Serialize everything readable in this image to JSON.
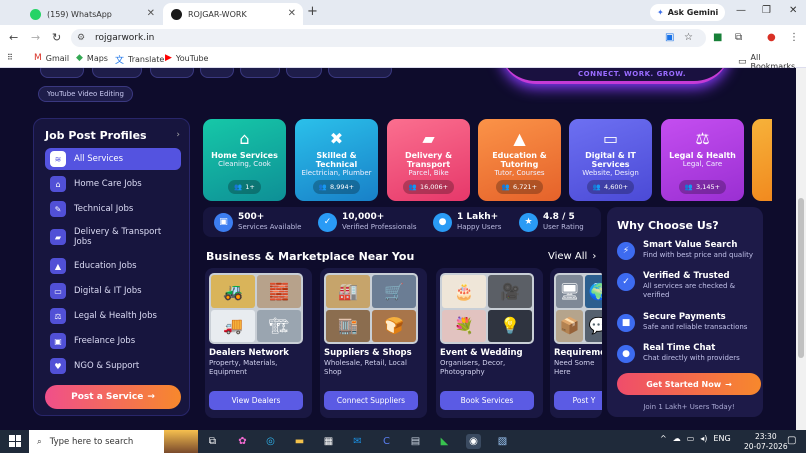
{
  "browser": {
    "tabs": [
      {
        "title": "(159) WhatsApp",
        "icon": "whatsapp-icon",
        "color": "#25d366"
      },
      {
        "title": "ROJGAR-WORK",
        "icon": "site-icon",
        "color": "#1a1a1a"
      }
    ],
    "new_tab": "+",
    "gemini": "Ask Gemini",
    "url": "rojgarwork.in",
    "bookmarks": [
      {
        "label": "Gmail",
        "icon": "gmail-icon"
      },
      {
        "label": "Maps",
        "icon": "maps-icon"
      },
      {
        "label": "Translate",
        "icon": "translate-icon"
      },
      {
        "label": "YouTube",
        "icon": "youtube-icon"
      }
    ],
    "all_bookmarks": "All Bookmarks"
  },
  "chips": [
    "YouTube Video Editing"
  ],
  "hero_text": "CONNECT. WORK. GROW.",
  "sidebar": {
    "title": "Job Post Profiles",
    "items": [
      {
        "label": "All Services",
        "icon": "layers-icon",
        "active": true
      },
      {
        "label": "Home Care Jobs",
        "icon": "home-icon"
      },
      {
        "label": "Technical Jobs",
        "icon": "wrench-icon"
      },
      {
        "label": "Delivery & Transport Jobs",
        "icon": "truck-icon"
      },
      {
        "label": "Education Jobs",
        "icon": "graduation-icon"
      },
      {
        "label": "Digital & IT Jobs",
        "icon": "laptop-icon"
      },
      {
        "label": "Legal & Health Jobs",
        "icon": "scale-icon"
      },
      {
        "label": "Freelance Jobs",
        "icon": "briefcase-icon"
      },
      {
        "label": "NGO & Support",
        "icon": "heart-hand-icon"
      }
    ],
    "post_button": "Post a Service"
  },
  "categories": [
    {
      "title": "Home Services",
      "sub": "Cleaning, Cook",
      "count": "1+",
      "icon": "home-icon",
      "color": "#12b4a0"
    },
    {
      "title": "Skilled & Technical",
      "sub": "Electrician, Plumber",
      "count": "8,994+",
      "icon": "tools-icon",
      "color": "#1aa6d8"
    },
    {
      "title": "Delivery & Transport",
      "sub": "Parcel, Bike",
      "count": "16,006+",
      "icon": "truck-icon",
      "color": "#f0567c"
    },
    {
      "title": "Education & Tutoring",
      "sub": "Tutor, Courses",
      "count": "6,721+",
      "icon": "graduation-icon",
      "color": "#f57d3a"
    },
    {
      "title": "Digital & IT Services",
      "sub": "Website, Design",
      "count": "4,600+",
      "icon": "laptop-icon",
      "color": "#5b5fe6"
    },
    {
      "title": "Legal & Health",
      "sub": "Legal, Care",
      "count": "3,145+",
      "icon": "scale-icon",
      "color": "#b43fe0"
    }
  ],
  "stats": [
    {
      "value": "500+",
      "label": "Services Available",
      "icon": "briefcase-icon",
      "color": "#3c7df0"
    },
    {
      "value": "10,000+",
      "label": "Verified Professionals",
      "icon": "check-icon",
      "color": "#2a9bf5"
    },
    {
      "value": "1 Lakh+",
      "label": "Happy Users",
      "icon": "user-icon",
      "color": "#2a9bf5"
    },
    {
      "value": "4.8 / 5",
      "label": "User Rating",
      "icon": "star-icon",
      "color": "#2a9bf5"
    }
  ],
  "business": {
    "title": "Business & Marketplace Near You",
    "view_all": "View All",
    "cards": [
      {
        "title": "Dealers Network",
        "desc": "Property, Materials, Equipment",
        "button": "View Dealers",
        "icons": [
          "🚜",
          "🧱",
          "🚚",
          "🏗"
        ]
      },
      {
        "title": "Suppliers & Shops",
        "desc": "Wholesale, Retail, Local Shop",
        "button": "Connect Suppliers",
        "icons": [
          "🏭",
          "🛒",
          "🏬",
          "🍞"
        ]
      },
      {
        "title": "Event & Wedding",
        "desc": "Organisers, Decor, Photography",
        "button": "Book Services",
        "icons": [
          "🎂",
          "🎥",
          "💐",
          "💡"
        ]
      },
      {
        "title": "Requireme",
        "desc": "Need Some Here",
        "button": "Post Y",
        "icons": [
          "🖥",
          "🌍",
          "📦",
          "💬"
        ]
      }
    ]
  },
  "why": {
    "title": "Why Choose Us?",
    "items": [
      {
        "title": "Smart Value Search",
        "desc": "Find with best price and quality",
        "icon": "bolt-icon"
      },
      {
        "title": "Verified & Trusted",
        "desc": "All services are checked & verified",
        "icon": "check-icon"
      },
      {
        "title": "Secure Payments",
        "desc": "Safe and reliable transactions",
        "icon": "lock-icon"
      },
      {
        "title": "Real Time Chat",
        "desc": "Chat directly with providers",
        "icon": "chat-icon"
      }
    ],
    "button": "Get Started Now",
    "footer": "Join 1 Lakh+ Users Today!"
  },
  "taskbar": {
    "search": "Type here to search",
    "lang": "ENG",
    "time": "23:30",
    "date": "20-07-2026"
  }
}
